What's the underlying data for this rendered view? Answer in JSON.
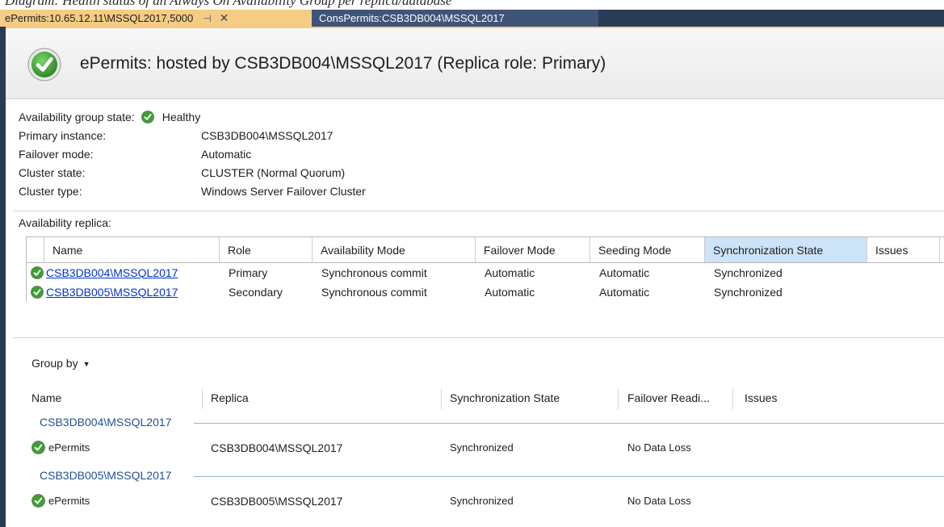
{
  "caption_fragment": "Diagram: Health status of an Always On Availability Group per replica/database",
  "tabs": [
    {
      "label": "ePermits:10.65.12.11\\MSSQL2017,5000",
      "active": true
    },
    {
      "label": "ConsPermits:CSB3DB004\\MSSQL2017",
      "active": false
    }
  ],
  "header": {
    "title": "ePermits: hosted by CSB3DB004\\MSSQL2017 (Replica role: Primary)"
  },
  "info": {
    "ag_state_label": "Availability group state:",
    "ag_state_value": "Healthy",
    "primary_label": "Primary instance:",
    "primary_value": "CSB3DB004\\MSSQL2017",
    "failover_label": "Failover mode:",
    "failover_value": "Automatic",
    "cluster_state_label": "Cluster state:",
    "cluster_state_value": "CLUSTER (Normal Quorum)",
    "cluster_type_label": "Cluster type:",
    "cluster_type_value": "Windows Server Failover Cluster"
  },
  "replicas": {
    "section_label": "Availability replica:",
    "columns": [
      "Name",
      "Role",
      "Availability Mode",
      "Failover Mode",
      "Seeding Mode",
      "Synchronization State",
      "Issues"
    ],
    "sorted_column": "Synchronization State",
    "rows": [
      {
        "name": "CSB3DB004\\MSSQL2017",
        "role": "Primary",
        "availability_mode": "Synchronous commit",
        "failover_mode": "Automatic",
        "seeding_mode": "Automatic",
        "sync_state": "Synchronized",
        "issues": ""
      },
      {
        "name": "CSB3DB005\\MSSQL2017",
        "role": "Secondary",
        "availability_mode": "Synchronous commit",
        "failover_mode": "Automatic",
        "seeding_mode": "Automatic",
        "sync_state": "Synchronized",
        "issues": ""
      }
    ]
  },
  "databases": {
    "group_by_label": "Group by",
    "columns": [
      "Name",
      "Replica",
      "Synchronization State",
      "Failover Readi...",
      "Issues"
    ],
    "groups": [
      {
        "header": "CSB3DB004\\MSSQL2017",
        "rows": [
          {
            "name": "ePermits",
            "replica": "CSB3DB004\\MSSQL2017",
            "sync_state": "Synchronized",
            "failover_readiness": "No Data Loss"
          }
        ]
      },
      {
        "header": "CSB3DB005\\MSSQL2017",
        "rows": [
          {
            "name": "ePermits",
            "replica": "CSB3DB005\\MSSQL2017",
            "sync_state": "Synchronized",
            "failover_readiness": "No Data Loss"
          }
        ]
      }
    ]
  },
  "colors": {
    "tab_active": "#f5cc84",
    "tab_inactive": "#3f5478",
    "tab_bar": "#2b3b55",
    "healthy_green": "#3aa12f",
    "link_blue": "#0033cc",
    "group_blue": "#1f4e99",
    "sorted_header": "#cde3f7"
  },
  "icons": {
    "healthy": "check-circle-icon",
    "pin": "pin-icon",
    "close": "close-icon",
    "caret": "chevron-down-icon"
  }
}
